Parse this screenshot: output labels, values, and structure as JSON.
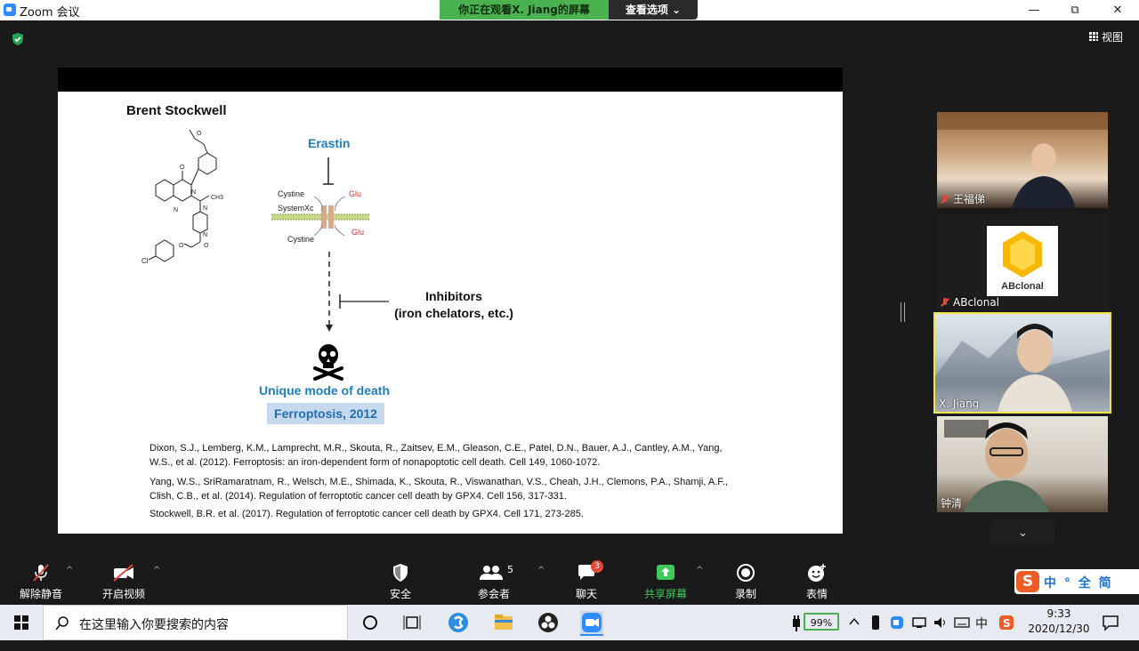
{
  "window": {
    "title": "Zoom 会议",
    "share_banner": "你正在观看X. Jiang的屏幕",
    "share_options": "查看选项 ⌄",
    "controls": [
      "—",
      "⧉",
      "✕"
    ]
  },
  "meeting": {
    "view_label": "视图",
    "colors": {
      "share_green": "#4ab34f",
      "active_speaker": "#f4e24a",
      "accent_blue": "#1e7fc0",
      "glu_red": "#d0312d"
    }
  },
  "slide": {
    "speaker": "Brent Stockwell",
    "molecule_label": "Cl",
    "molecule_ch3": "CH3",
    "erastin": "Erastin",
    "cystine_top": "Cystine",
    "system_xc": "SystemXc",
    "glu_top": "Glu",
    "glu_bottom": "Glu",
    "cystine_bottom": "Cystine",
    "inhibitors_line1": "Inhibitors",
    "inhibitors_line2": "(iron chelators, etc.)",
    "unique": "Unique mode of death",
    "ferroptosis": "Ferroptosis, 2012",
    "refs": [
      "Dixon, S.J., Lemberg, K.M., Lamprecht, M.R., Skouta, R., Zaitsev, E.M., Gleason, C.E., Patel, D.N., Bauer, A.J., Cantley, A.M., Yang, W.S., et al. (2012). Ferroptosis: an iron-dependent form of nonapoptotic cell death. Cell 149, 1060-1072.",
      "Yang, W.S., SriRamaratnam, R., Welsch, M.E., Shimada, K., Skouta, R., Viswanathan, V.S., Cheah, J.H., Clemons, P.A., Shamji, A.F., Clish, C.B., et al. (2014). Regulation of ferroptotic cancer cell death by GPX4. Cell 156, 317-331.",
      "Stockwell, B.R. et al. (2017). Regulation of ferroptotic cancer cell death by GPX4. Cell 171, 273-285."
    ]
  },
  "participants": [
    {
      "name": "王福俤",
      "muted": true
    },
    {
      "name": "ABclonal",
      "muted": true,
      "logo_text": "ABclonal"
    },
    {
      "name": "X. Jiang",
      "muted": false,
      "active": true
    },
    {
      "name": "钟清",
      "muted": false
    }
  ],
  "toolbar": {
    "unmute": "解除静音",
    "start_video": "开启视频",
    "security": "安全",
    "participants": "参会者",
    "participants_count": "5",
    "chat": "聊天",
    "chat_badge": "3",
    "share_screen": "共享屏幕",
    "record": "录制",
    "reactions": "表情"
  },
  "ime": {
    "text": "中 ° 全 简"
  },
  "taskbar": {
    "search_placeholder": "在这里输入你要搜索的内容",
    "battery": "99%",
    "ime_tray": "中",
    "time": "9:33",
    "date": "2020/12/30"
  }
}
